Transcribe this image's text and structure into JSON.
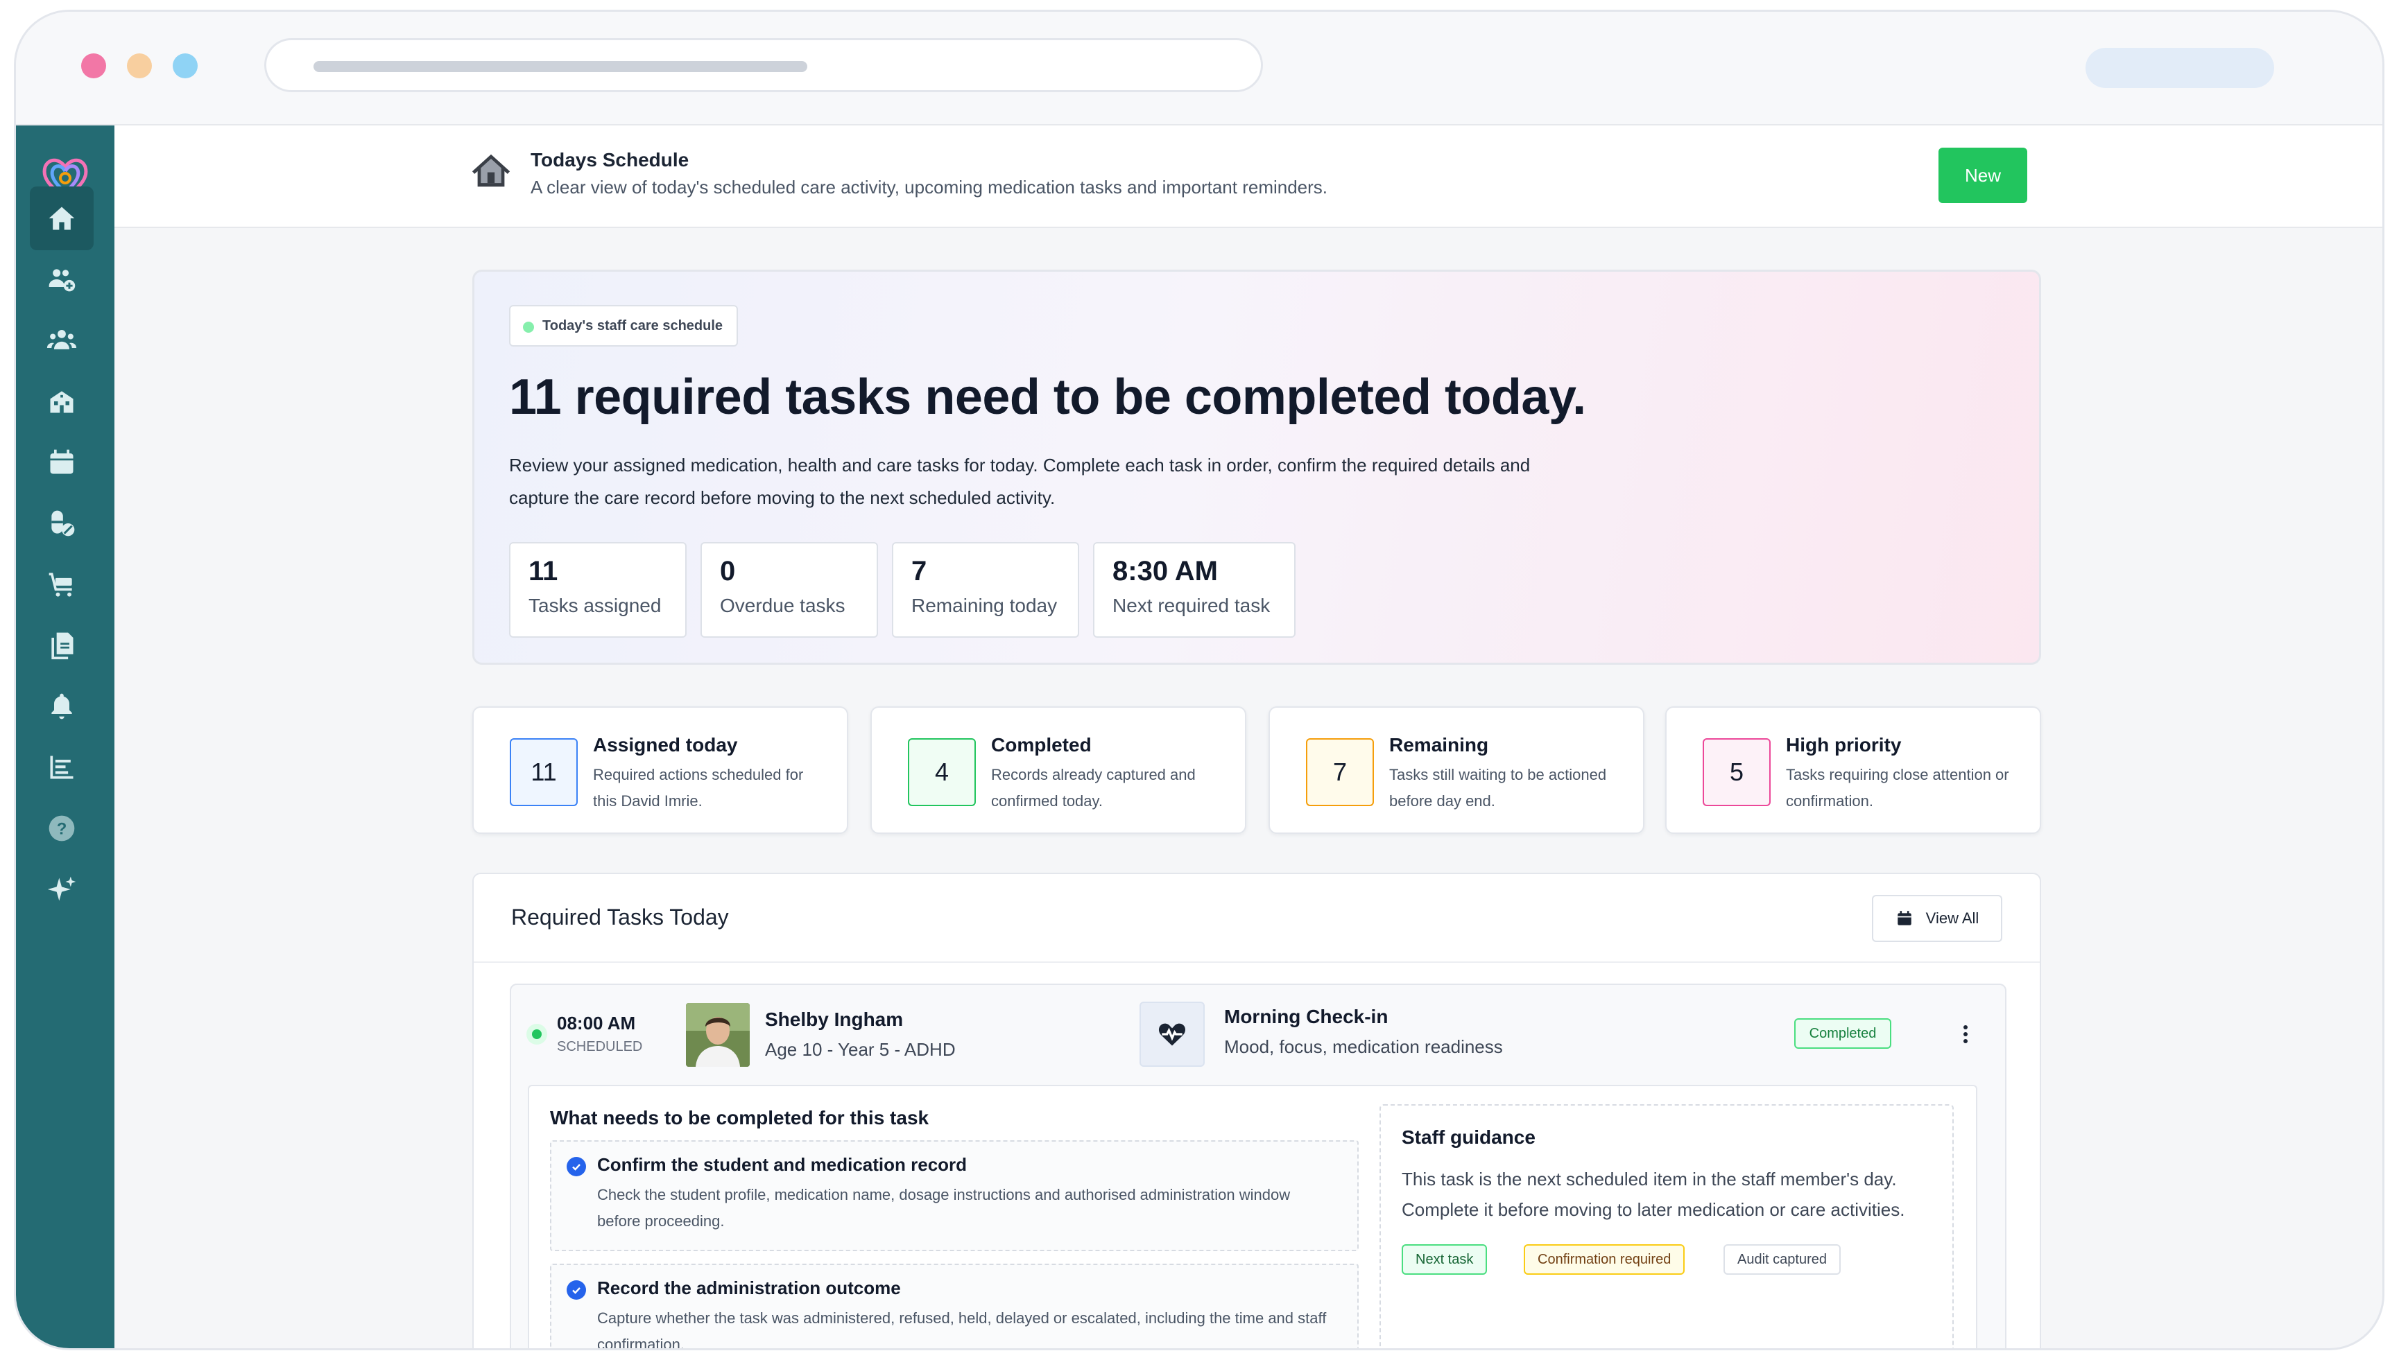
{
  "header": {
    "title": "Todays Schedule",
    "subtitle": "A clear view of today's scheduled care activity, upcoming medication tasks and important reminders.",
    "new_button": "New"
  },
  "sidebar": {
    "items": [
      {
        "icon": "home-icon",
        "active": true
      },
      {
        "icon": "group-add-icon"
      },
      {
        "icon": "people-icon"
      },
      {
        "icon": "building-icon"
      },
      {
        "icon": "calendar-icon"
      },
      {
        "icon": "medication-icon"
      },
      {
        "icon": "cart-icon"
      },
      {
        "icon": "documents-icon"
      },
      {
        "icon": "bell-icon"
      },
      {
        "icon": "reports-icon"
      },
      {
        "icon": "help-icon"
      },
      {
        "icon": "sparkle-icon"
      }
    ]
  },
  "hero": {
    "badge": "Today's staff care schedule",
    "title": "11 required tasks need to be completed today.",
    "description": "Review your assigned medication, health and care tasks for today. Complete each task in order, confirm the required details and capture the care record before moving to the next scheduled activity.",
    "stats": [
      {
        "value": "11",
        "label": "Tasks assigned"
      },
      {
        "value": "0",
        "label": "Overdue tasks"
      },
      {
        "value": "7",
        "label": "Remaining today"
      },
      {
        "value": "8:30 AM",
        "label": "Next required task"
      }
    ]
  },
  "summary": [
    {
      "value": "11",
      "title": "Assigned today",
      "desc": "Required actions scheduled for this David Imrie.",
      "color": "#3b82f6",
      "bg": "#eff6ff"
    },
    {
      "value": "4",
      "title": "Completed",
      "desc": "Records already captured and confirmed today.",
      "color": "#22c55e",
      "bg": "#f0fdf4"
    },
    {
      "value": "7",
      "title": "Remaining",
      "desc": "Tasks still waiting to be actioned before day end.",
      "color": "#f59e0b",
      "bg": "#fffbeb"
    },
    {
      "value": "5",
      "title": "High priority",
      "desc": "Tasks requiring close attention or confirmation.",
      "color": "#ec4899",
      "bg": "#fdf2f8"
    }
  ],
  "tasks": {
    "title": "Required Tasks Today",
    "view_all": "View All",
    "items": [
      {
        "time": "08:00 AM",
        "status": "SCHEDULED",
        "person_name": "Shelby Ingham",
        "person_meta": "Age 10 - Year 5 - ADHD",
        "activity": "Morning Check-in",
        "activity_meta": "Mood, focus, medication readiness",
        "badge": "Completed",
        "need_title": "What needs to be completed for this task",
        "requirements": [
          {
            "title": "Confirm the student and medication record",
            "desc": "Check the student profile, medication name, dosage instructions and authorised administration window before proceeding."
          },
          {
            "title": "Record the administration outcome",
            "desc": "Capture whether the task was administered, refused, held, delayed or escalated, including the time and staff confirmation."
          }
        ],
        "guidance_title": "Staff guidance",
        "guidance_desc": "This task is the next scheduled item in the staff member's day. Complete it before moving to later medication or care activities.",
        "tags": [
          "Next task",
          "Confirmation required",
          "Audit captured"
        ]
      }
    ]
  }
}
